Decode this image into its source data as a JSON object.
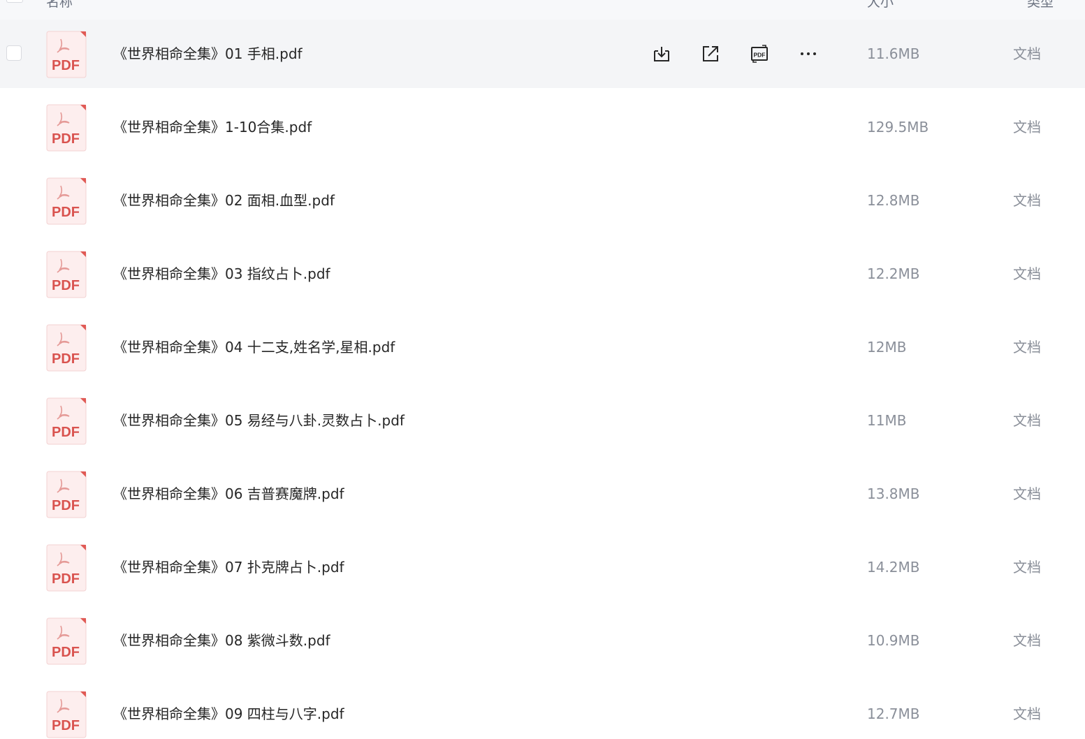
{
  "header": {
    "name_col": "名称",
    "size_col": "大小",
    "type_col": "类型"
  },
  "icons": {
    "file": "pdf-file-icon",
    "download": "download-icon",
    "share": "share-icon",
    "convert": "pdf-convert-icon",
    "more": "more-icon"
  },
  "colors": {
    "pdf_red": "#d9534f",
    "hover_row": "#f4f5f7"
  },
  "files": [
    {
      "name": "《世界相命全集》01 手相.pdf",
      "size": "11.6MB",
      "type": "文档"
    },
    {
      "name": "《世界相命全集》1-10合集.pdf",
      "size": "129.5MB",
      "type": "文档"
    },
    {
      "name": "《世界相命全集》02 面相.血型.pdf",
      "size": "12.8MB",
      "type": "文档"
    },
    {
      "name": "《世界相命全集》03 指纹占卜.pdf",
      "size": "12.2MB",
      "type": "文档"
    },
    {
      "name": "《世界相命全集》04 十二支,姓名学,星相.pdf",
      "size": "12MB",
      "type": "文档"
    },
    {
      "name": "《世界相命全集》05 易经与八卦.灵数占卜.pdf",
      "size": "11MB",
      "type": "文档"
    },
    {
      "name": "《世界相命全集》06 吉普赛魔牌.pdf",
      "size": "13.8MB",
      "type": "文档"
    },
    {
      "name": "《世界相命全集》07 扑克牌占卜.pdf",
      "size": "14.2MB",
      "type": "文档"
    },
    {
      "name": "《世界相命全集》08 紫微斗数.pdf",
      "size": "10.9MB",
      "type": "文档"
    },
    {
      "name": "《世界相命全集》09 四柱与八字.pdf",
      "size": "12.7MB",
      "type": "文档"
    }
  ]
}
